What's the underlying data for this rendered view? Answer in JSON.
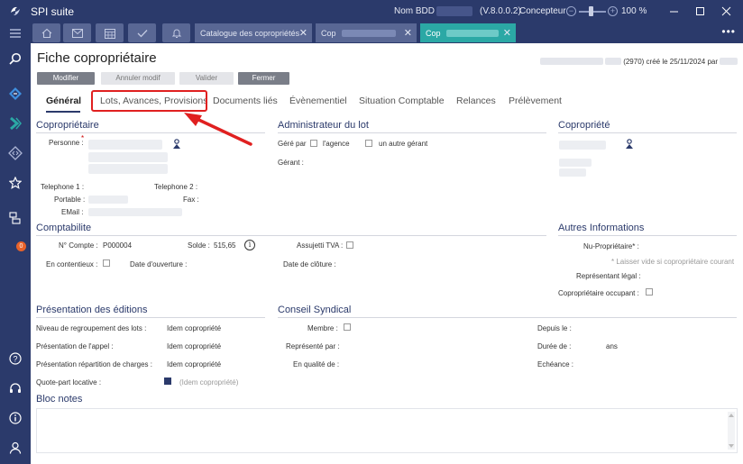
{
  "app": {
    "name": "SPI suite",
    "nom_bdd_label": "Nom BDD :",
    "version": "(V.8.0.0.2)",
    "user": "Concepteur",
    "zoom": "100 %",
    "zoom_minus": "−",
    "zoom_plus": "+"
  },
  "tabs": {
    "icon_buttons": [
      "home-icon",
      "mail-icon",
      "calendar-icon",
      "check-icon",
      "bell-icon"
    ],
    "documents": [
      {
        "label": "Catalogue des copropriétés",
        "close": "✕"
      },
      {
        "label": "Cop",
        "close": "✕"
      },
      {
        "label": "Cop",
        "close": "✕"
      }
    ],
    "more": "•••"
  },
  "sidebar": {
    "items": [
      "menu-icon",
      "search-icon",
      "nav-diamond-icon",
      "nav-chevron-icon",
      "nav-code-icon",
      "star-icon",
      "network-icon",
      "help-icon",
      "headset-icon",
      "info-icon",
      "user-icon"
    ],
    "badge": "0"
  },
  "page": {
    "title": "Fiche copropriétaire",
    "created_mid": "(2970) créé le 25/11/2024 par",
    "buttons": {
      "modifier": "Modifier",
      "annuler": "Annuler modif",
      "valider": "Valider",
      "fermer": "Fermer"
    }
  },
  "subtabs": [
    "Général",
    "Lots, Avances, Provisions",
    "Documents liés",
    "Évènementiel",
    "Situation Comptable",
    "Relances",
    "Prélèvement"
  ],
  "coproprietaire": {
    "title": "Copropriétaire",
    "personne": "Personne :",
    "asterisk": "*",
    "telephone1": "Telephone 1 :",
    "telephone2": "Telephone 2 :",
    "portable": "Portable :",
    "fax": "Fax :",
    "email": "EMail :"
  },
  "administrateur": {
    "title": "Administrateur du lot",
    "gere_par": "Géré par",
    "agence": "l'agence",
    "autre": "un autre gérant",
    "gerant": "Gérant :"
  },
  "copropriete": {
    "title": "Copropriété"
  },
  "comptabilite": {
    "title": "Comptabilite",
    "compte_label": "N° Compte :",
    "compte_value": "P000004",
    "solde_label": "Solde :",
    "solde_value": "515,65",
    "info": "i",
    "assujetti": "Assujetti TVA :",
    "contentieux": "En contentieux :",
    "ouverture": "Date d'ouverture :",
    "cloture": "Date de clôture :"
  },
  "autres": {
    "title": "Autres Informations",
    "nu_proprietaire": "Nu-Propriétaire* :",
    "hint": "* Laisser vide si copropriétaire courant",
    "representant": "Représentant légal :",
    "occupant": "Copropriétaire occupant :"
  },
  "presentation": {
    "title": "Présentation des éditions",
    "rows": [
      {
        "label": "Niveau de regroupement des lots :",
        "value": "Idem copropriété"
      },
      {
        "label": "Présentation de l'appel :",
        "value": "Idem copropriété"
      },
      {
        "label": "Présentation répartition de charges :",
        "value": "Idem copropriété"
      }
    ],
    "quote_label": "Quote-part locative :",
    "quote_value": "(Idem copropriété)"
  },
  "conseil": {
    "title": "Conseil Syndical",
    "membre": "Membre :",
    "represente": "Représenté par :",
    "qualite": "En qualité de :",
    "depuis": "Depuis le :",
    "duree": "Durée de :",
    "ans": "ans",
    "echeance": "Echéance :"
  },
  "notes": {
    "title": "Bloc notes"
  },
  "colors": {
    "navy": "#2b3a6b",
    "teal": "#2ba8a5",
    "highlight": "#e02020",
    "badge": "#e8622a"
  }
}
